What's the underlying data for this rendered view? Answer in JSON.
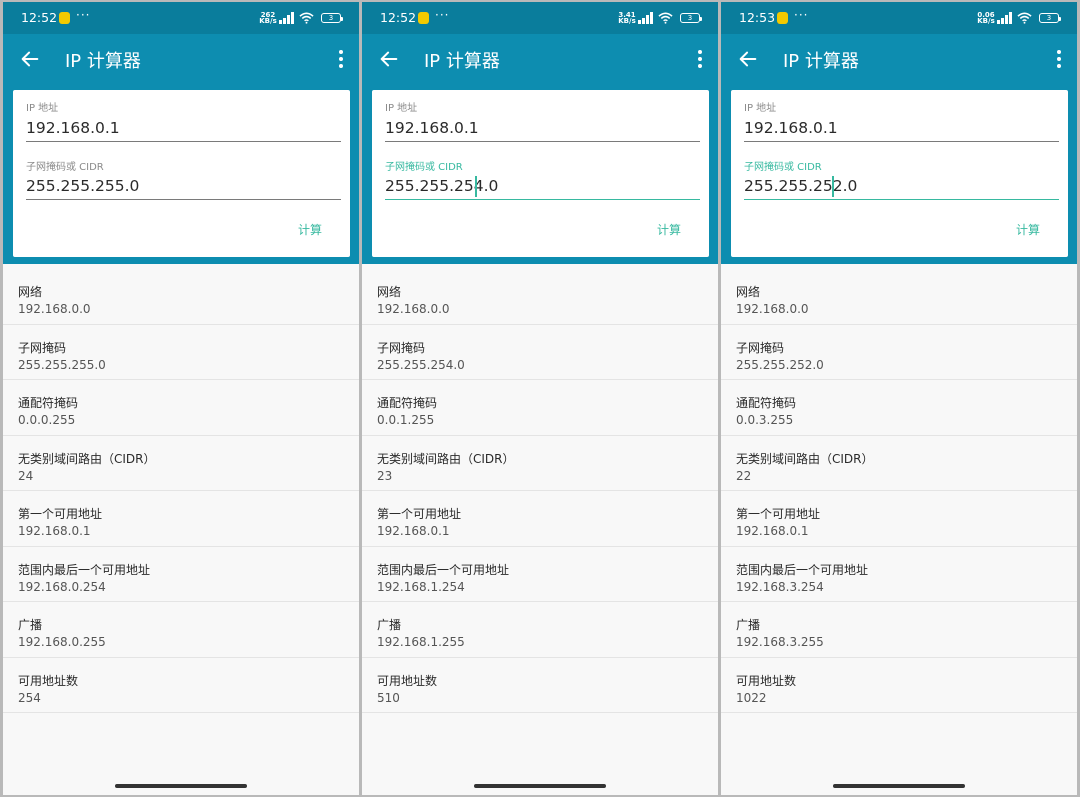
{
  "colors": {
    "status_bar": "#0a7d9c",
    "app_bar": "#0d8db0",
    "accent": "#37b9a0"
  },
  "icons": {
    "back": "arrow-left-icon",
    "more": "more-vert-icon",
    "signal": "signal-icon",
    "wifi": "wifi-icon",
    "battery": "battery-icon"
  },
  "panels": [
    {
      "status": {
        "time": "12:52",
        "dots": "···",
        "net_speed": "262",
        "net_unit": "KB/s",
        "battery": "3"
      },
      "appbar": {
        "title": "IP 计算器"
      },
      "form": {
        "ip_label": "IP 地址",
        "ip_value": "192.168.0.1",
        "mask_label": "子网掩码或 CIDR",
        "mask_value": "255.255.255.0",
        "calc_button": "计算"
      },
      "results": [
        {
          "label": "网络",
          "value": "192.168.0.0"
        },
        {
          "label": "子网掩码",
          "value": "255.255.255.0"
        },
        {
          "label": "通配符掩码",
          "value": "0.0.0.255"
        },
        {
          "label": "无类别域间路由（CIDR）",
          "value": "24"
        },
        {
          "label": "第一个可用地址",
          "value": "192.168.0.1"
        },
        {
          "label": "范围内最后一个可用地址",
          "value": "192.168.0.254"
        },
        {
          "label": "广播",
          "value": "192.168.0.255"
        },
        {
          "label": "可用地址数",
          "value": "254"
        }
      ]
    },
    {
      "status": {
        "time": "12:52",
        "dots": "···",
        "net_speed": "3.41",
        "net_unit": "KB/s",
        "battery": "3"
      },
      "appbar": {
        "title": "IP 计算器"
      },
      "form": {
        "ip_label": "IP 地址",
        "ip_value": "192.168.0.1",
        "mask_label": "子网掩码或 CIDR",
        "mask_value": "255.255.254.0",
        "calc_button": "计算"
      },
      "results": [
        {
          "label": "网络",
          "value": "192.168.0.0"
        },
        {
          "label": "子网掩码",
          "value": "255.255.254.0"
        },
        {
          "label": "通配符掩码",
          "value": "0.0.1.255"
        },
        {
          "label": "无类别域间路由（CIDR）",
          "value": "23"
        },
        {
          "label": "第一个可用地址",
          "value": "192.168.0.1"
        },
        {
          "label": "范围内最后一个可用地址",
          "value": "192.168.1.254"
        },
        {
          "label": "广播",
          "value": "192.168.1.255"
        },
        {
          "label": "可用地址数",
          "value": "510"
        }
      ]
    },
    {
      "status": {
        "time": "12:53",
        "dots": "···",
        "net_speed": "0.06",
        "net_unit": "KB/s",
        "battery": "3"
      },
      "appbar": {
        "title": "IP 计算器"
      },
      "form": {
        "ip_label": "IP 地址",
        "ip_value": "192.168.0.1",
        "mask_label": "子网掩码或 CIDR",
        "mask_value": "255.255.252.0",
        "calc_button": "计算"
      },
      "results": [
        {
          "label": "网络",
          "value": "192.168.0.0"
        },
        {
          "label": "子网掩码",
          "value": "255.255.252.0"
        },
        {
          "label": "通配符掩码",
          "value": "0.0.3.255"
        },
        {
          "label": "无类别域间路由（CIDR）",
          "value": "22"
        },
        {
          "label": "第一个可用地址",
          "value": "192.168.0.1"
        },
        {
          "label": "范围内最后一个可用地址",
          "value": "192.168.3.254"
        },
        {
          "label": "广播",
          "value": "192.168.3.255"
        },
        {
          "label": "可用地址数",
          "value": "1022"
        }
      ]
    }
  ]
}
